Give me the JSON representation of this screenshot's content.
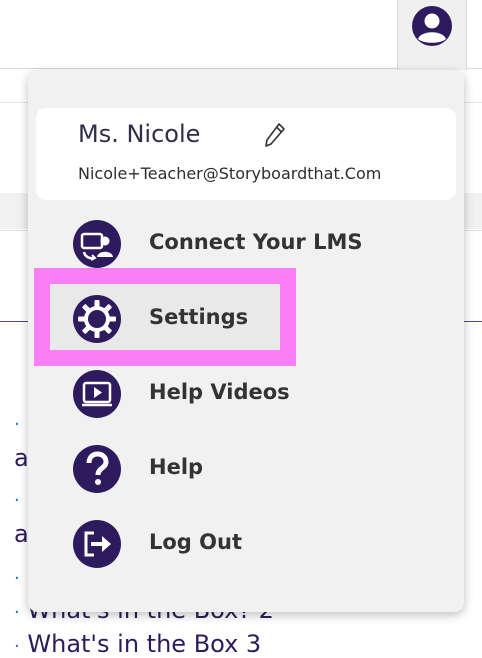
{
  "profile": {
    "icon": "user-avatar-icon"
  },
  "user": {
    "name": "Ms. Nicole",
    "email": "Nicole+Teacher@Storyboardthat.Com",
    "edit_icon": "pencil-icon"
  },
  "menu": [
    {
      "label": "Connect Your LMS",
      "icon": "lms-connect-icon"
    },
    {
      "label": "Settings",
      "icon": "gear-icon"
    },
    {
      "label": "Help Videos",
      "icon": "video-play-icon"
    },
    {
      "label": "Help",
      "icon": "question-icon"
    },
    {
      "label": "Log Out",
      "icon": "logout-icon"
    }
  ],
  "background_list": [
    {
      "bullet": "·",
      "text": ""
    },
    {
      "bullet": "",
      "text": "a"
    },
    {
      "bullet": "·",
      "text": ""
    },
    {
      "bullet": "",
      "text": "a"
    },
    {
      "bullet": "·",
      "text": ""
    },
    {
      "bullet": "·",
      "text": "What's in the Box? 2"
    },
    {
      "bullet": "·",
      "text": "What's in the Box 3"
    }
  ],
  "colors": {
    "accent": "#2e1b5e",
    "highlight": "#fa7ff5"
  }
}
